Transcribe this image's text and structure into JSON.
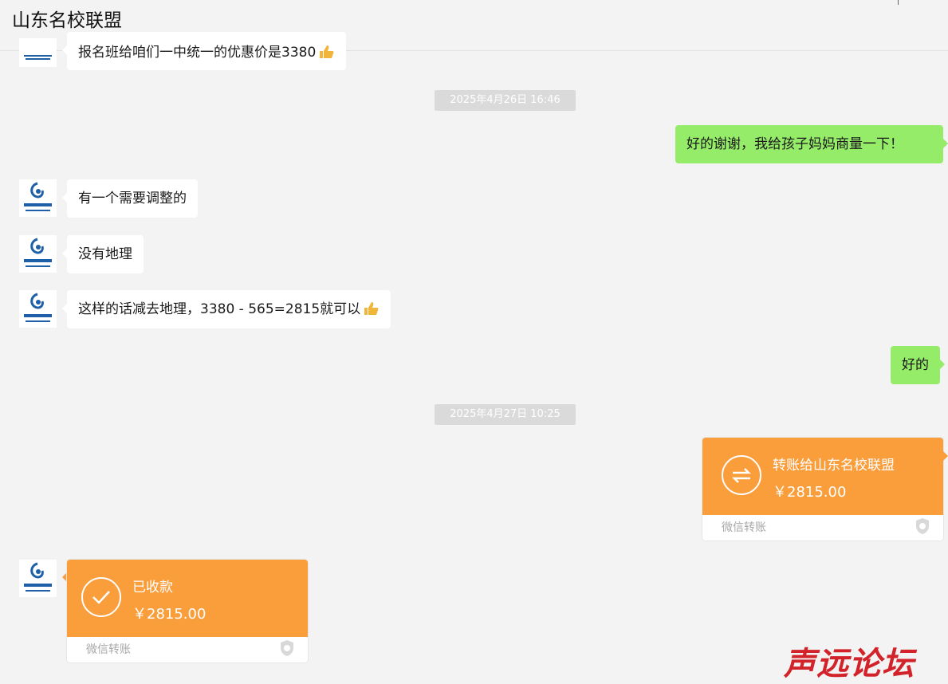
{
  "header": {
    "title": "山东名校联盟"
  },
  "messages": {
    "m0": "报名班给咱们一中统一的优惠价是3380",
    "t1": "2025年4月26日 16:46",
    "m1": "好的谢谢，我给孩子妈妈商量一下！",
    "m2": "有一个需要调整的",
    "m3": "没有地理",
    "m4": "这样的话减去地理，3380 - 565=2815就可以",
    "m5": "好的",
    "t2": "2025年4月27日 10:25"
  },
  "transfer_sent": {
    "title": "转账给山东名校联盟",
    "amount": "￥2815.00",
    "label": "微信转账"
  },
  "transfer_received": {
    "title": "已收款",
    "amount": "￥2815.00",
    "label": "微信转账"
  },
  "icons": {
    "thumb": "thumbs-up-emoji",
    "transfer": "transfer-arrows-icon",
    "received": "check-circle-icon",
    "shield": "shield-icon"
  },
  "colors": {
    "bubble_right": "#95ec69",
    "transfer": "#fa9d3b"
  },
  "watermark": "声远论坛"
}
